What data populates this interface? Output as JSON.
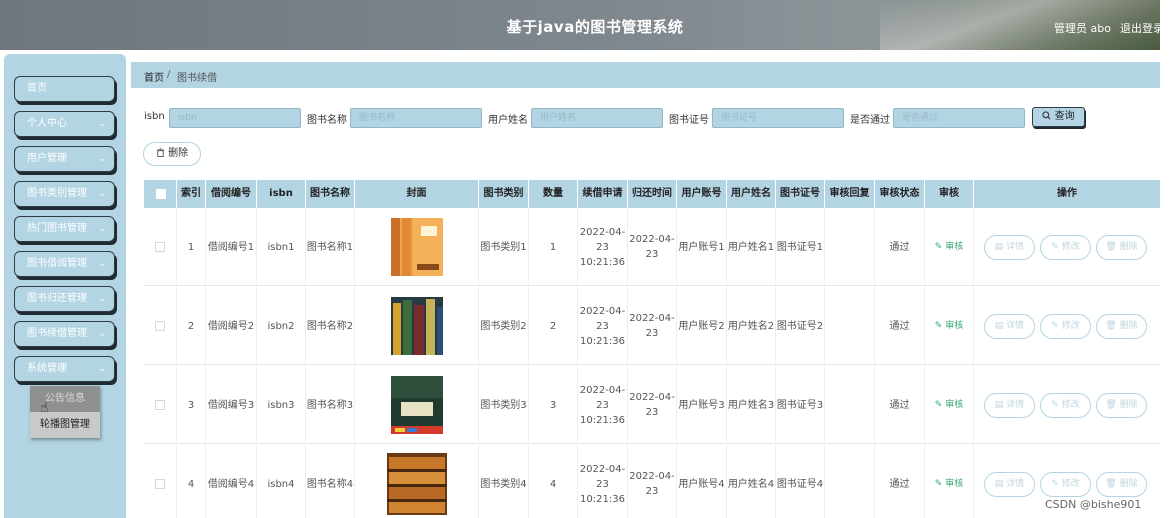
{
  "header": {
    "title": "基于java的图书管理系统",
    "user": "管理员 abo",
    "logout": "退出登录"
  },
  "sidebar": {
    "items": [
      {
        "label": "首页",
        "has_arrow": false
      },
      {
        "label": "个人中心",
        "has_arrow": true
      },
      {
        "label": "用户管理",
        "has_arrow": true
      },
      {
        "label": "图书类别管理",
        "has_arrow": true
      },
      {
        "label": "热门图书管理",
        "has_arrow": true
      },
      {
        "label": "图书借阅管理",
        "has_arrow": true
      },
      {
        "label": "图书归还管理",
        "has_arrow": true
      },
      {
        "label": "图书续借管理",
        "has_arrow": true
      },
      {
        "label": "系统管理",
        "has_arrow": true
      }
    ],
    "submenu": [
      "公告信息",
      "轮播图管理"
    ]
  },
  "breadcrumb": {
    "home": "首页",
    "separator": "/",
    "current": "图书续借"
  },
  "search": {
    "fields": [
      {
        "label": "isbn",
        "placeholder": "isbn"
      },
      {
        "label": "图书名称",
        "placeholder": "图书名称"
      },
      {
        "label": "用户姓名",
        "placeholder": "用户姓名"
      },
      {
        "label": "图书证号",
        "placeholder": "图书证号"
      },
      {
        "label": "是否通过",
        "placeholder": "是否通过"
      }
    ],
    "query_button": "查询",
    "query_icon": "search-icon"
  },
  "delete_button": "删除",
  "table": {
    "headers": [
      "索引",
      "借阅编号",
      "isbn",
      "图书名称",
      "封面",
      "图书类别",
      "数量",
      "续借申请",
      "归还时间",
      "用户账号",
      "用户姓名",
      "图书证号",
      "审核回复",
      "审核状态",
      "审核",
      "操作"
    ],
    "rows": [
      {
        "index": "1",
        "borrow_no": "借阅编号1",
        "isbn": "isbn1",
        "name": "图书名称1",
        "cover": "orange",
        "category": "图书类别1",
        "qty": "1",
        "apply": "2022-04-23 10:21:36",
        "return": "2022-04-23",
        "account": "用户账号1",
        "username": "用户姓名1",
        "card": "图书证号1",
        "reply": "",
        "status": "通过",
        "audit": "审核"
      },
      {
        "index": "2",
        "borrow_no": "借阅编号2",
        "isbn": "isbn2",
        "name": "图书名称2",
        "cover": "stack",
        "category": "图书类别2",
        "qty": "2",
        "apply": "2022-04-23 10:21:36",
        "return": "2022-04-23",
        "account": "用户账号2",
        "username": "用户姓名2",
        "card": "图书证号2",
        "reply": "",
        "status": "通过",
        "audit": "审核"
      },
      {
        "index": "3",
        "borrow_no": "借阅编号3",
        "isbn": "isbn3",
        "name": "图书名称3",
        "cover": "green",
        "category": "图书类别3",
        "qty": "3",
        "apply": "2022-04-23 10:21:36",
        "return": "2022-04-23",
        "account": "用户账号3",
        "username": "用户姓名3",
        "card": "图书证号3",
        "reply": "",
        "status": "通过",
        "audit": "审核"
      },
      {
        "index": "4",
        "borrow_no": "借阅编号4",
        "isbn": "isbn4",
        "name": "图书名称4",
        "cover": "shelf",
        "category": "图书类别4",
        "qty": "4",
        "apply": "2022-04-23 10:21:36",
        "return": "2022-04-23",
        "account": "用户账号4",
        "username": "用户姓名4",
        "card": "图书证号4",
        "reply": "",
        "status": "通过",
        "audit": "审核"
      }
    ],
    "ops": [
      "详情",
      "修改",
      "删除"
    ]
  },
  "watermark": "CSDN @bishe901",
  "colors": {
    "accent": "#b3d4e3",
    "header": "#7a8288",
    "audit": "#3aa876"
  }
}
